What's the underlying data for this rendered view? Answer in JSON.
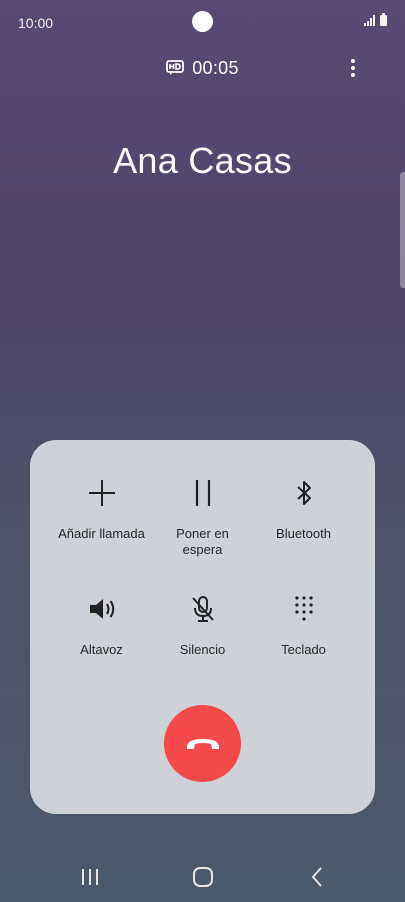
{
  "status_bar": {
    "time": "10:00"
  },
  "call": {
    "timer": "00:05",
    "caller_name": "Ana Casas"
  },
  "controls": [
    {
      "label": "Añadir llamada",
      "icon": "plus-icon"
    },
    {
      "label": "Poner en espera",
      "icon": "pause-icon"
    },
    {
      "label": "Bluetooth",
      "icon": "bluetooth-icon"
    },
    {
      "label": "Altavoz",
      "icon": "speaker-icon"
    },
    {
      "label": "Silencio",
      "icon": "mic-off-icon"
    },
    {
      "label": "Teclado",
      "icon": "keypad-icon"
    }
  ],
  "colors": {
    "end_call": "#f44a4a",
    "panel": "#cfd1d8",
    "background_top": "#584a73",
    "background_bottom": "#4b5a6a"
  }
}
